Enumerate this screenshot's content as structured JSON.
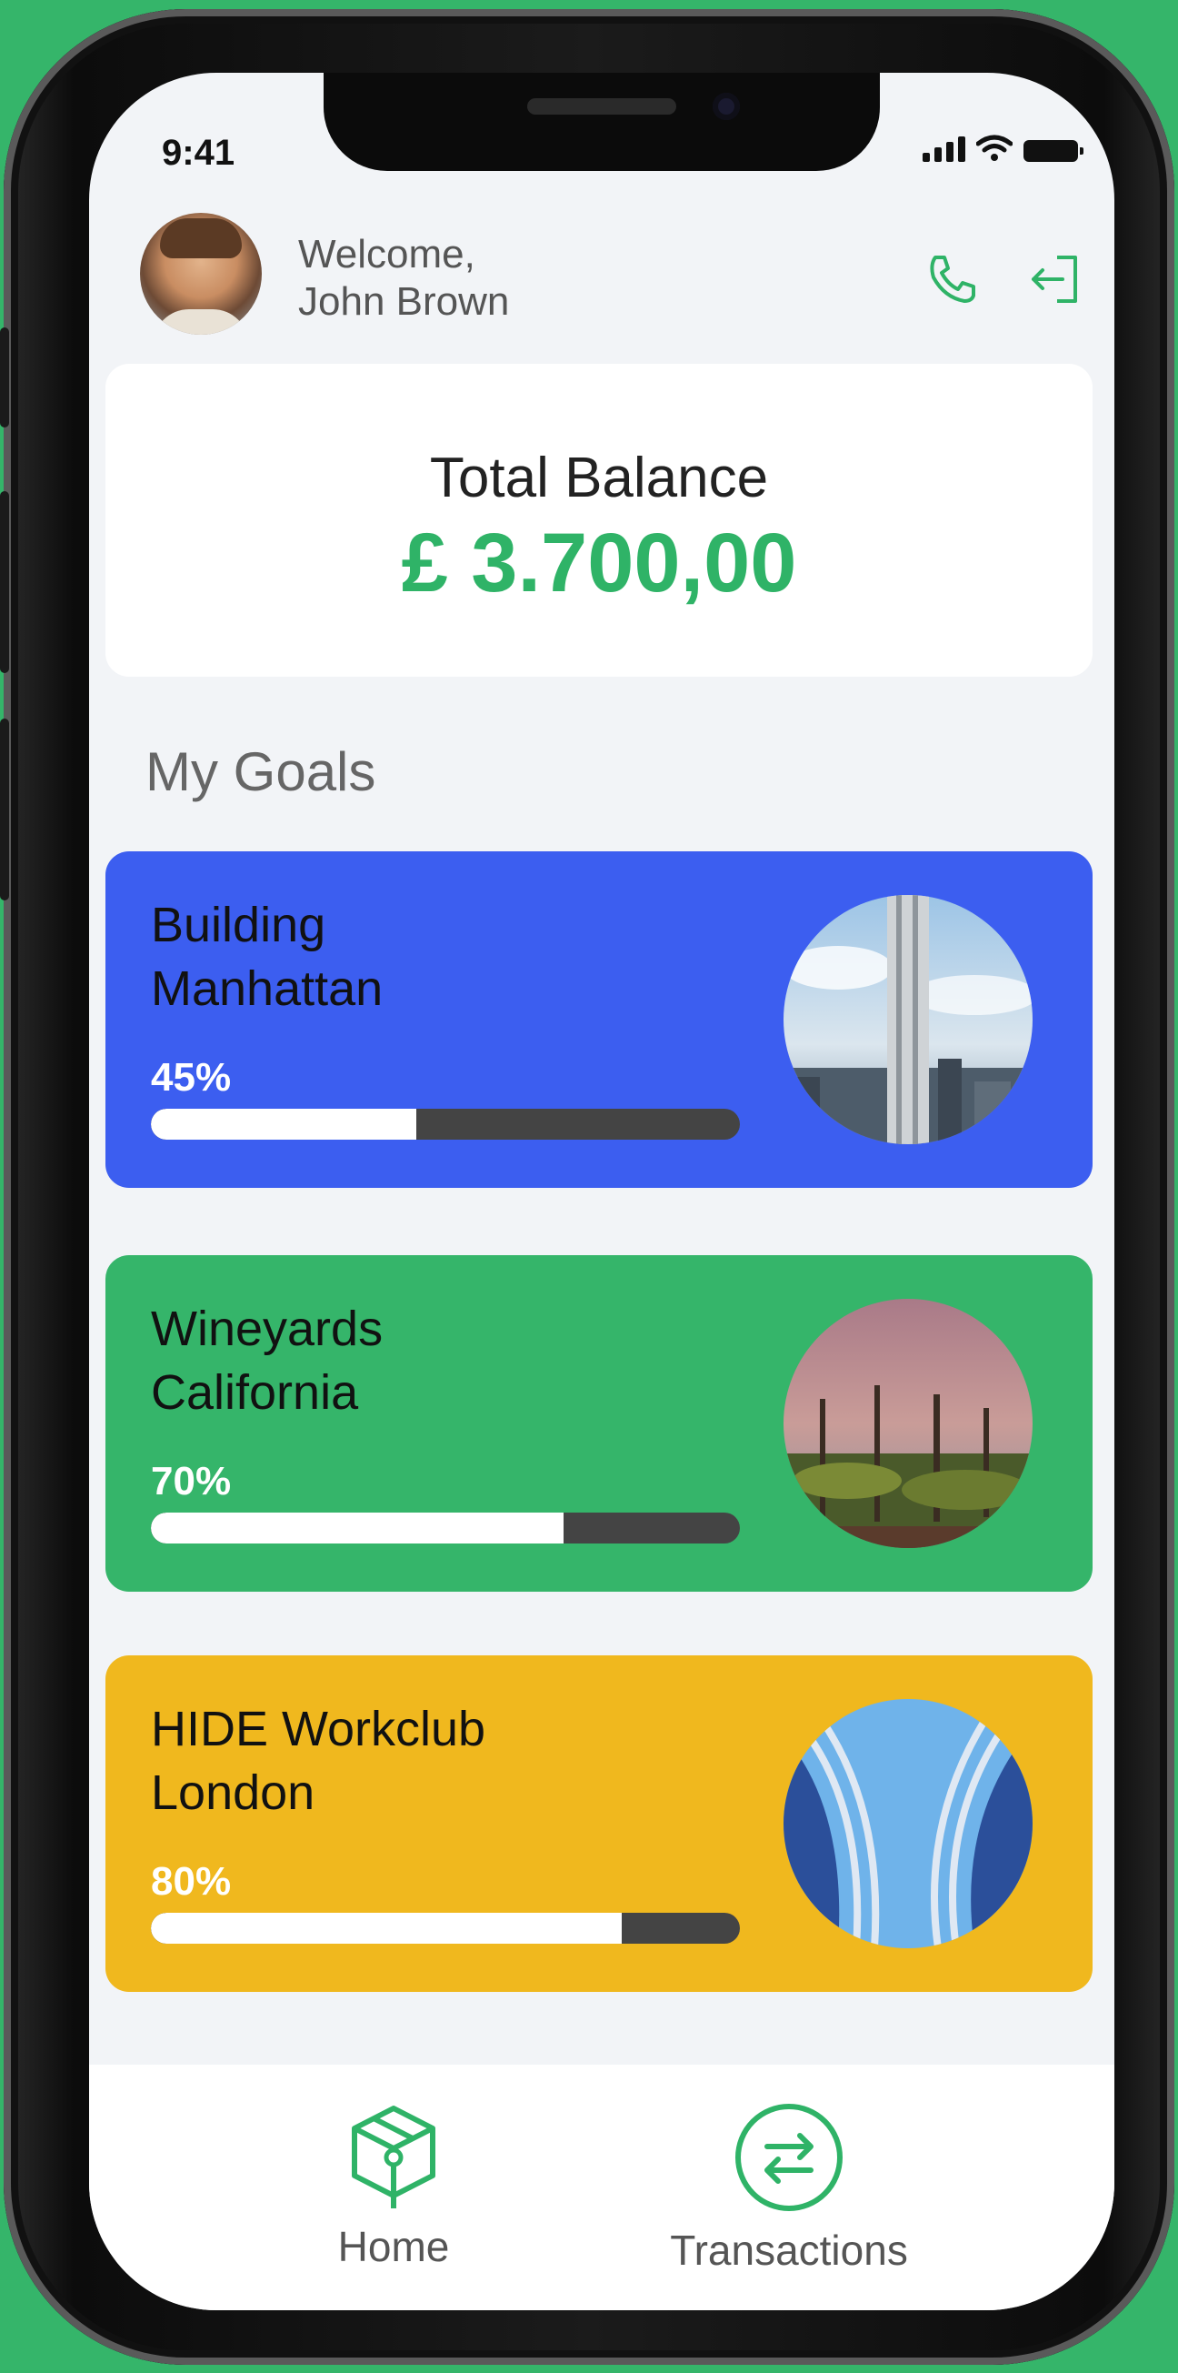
{
  "status_bar": {
    "time": "9:41"
  },
  "header": {
    "welcome_line": "Welcome,",
    "user_name": "John Brown",
    "call_icon": "phone-icon",
    "logout_icon": "logout-icon"
  },
  "balance": {
    "label": "Total Balance",
    "amount": "£ 3.700,00",
    "accent": "#2fb367"
  },
  "goals_section": {
    "title": "My Goals",
    "items": [
      {
        "name_line1": "Building",
        "name_line2": "Manhattan",
        "percent_label": "45%",
        "progress": 0.45,
        "color": "#3c5ef0"
      },
      {
        "name_line1": "Wineyards",
        "name_line2": "California",
        "percent_label": "70%",
        "progress": 0.7,
        "color": "#35b56a"
      },
      {
        "name_line1": "HIDE Workclub",
        "name_line2": "London",
        "percent_label": "80%",
        "progress": 0.8,
        "color": "#f0b81e"
      }
    ]
  },
  "bottom_nav": {
    "items": [
      {
        "label": "Home",
        "icon": "box-icon"
      },
      {
        "label": "Transactions",
        "icon": "transfer-icon"
      }
    ]
  }
}
